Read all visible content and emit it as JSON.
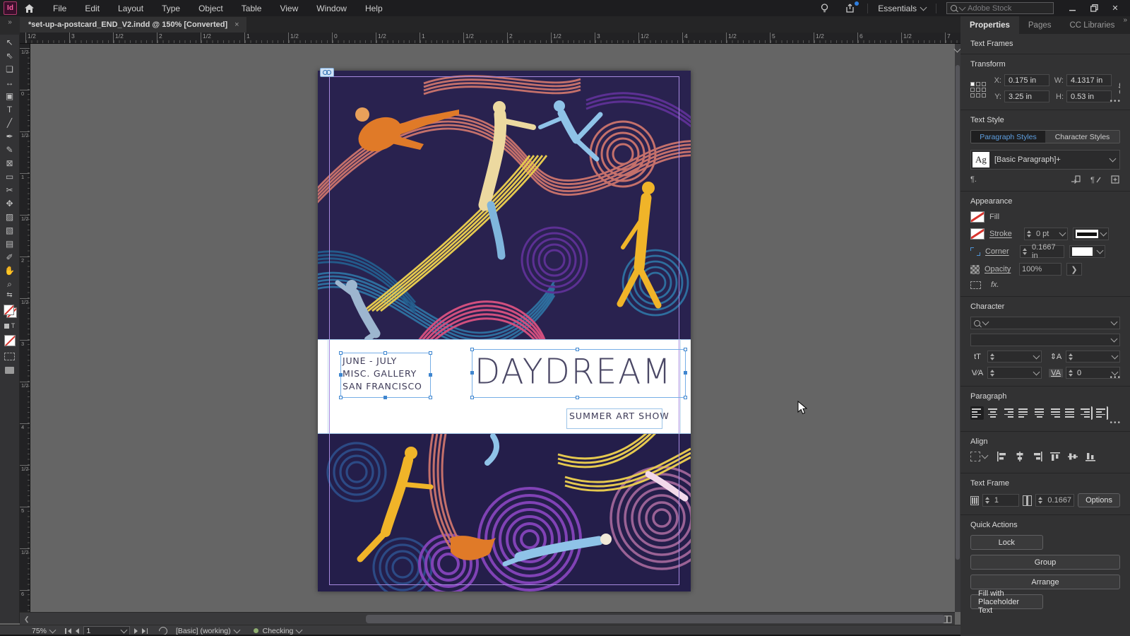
{
  "app": {
    "logo": "Id",
    "menus": [
      "File",
      "Edit",
      "Layout",
      "Type",
      "Object",
      "Table",
      "View",
      "Window",
      "Help"
    ],
    "workspace_label": "Essentials",
    "stock_placeholder": "Adobe Stock",
    "document_tab": "*set-up-a-postcard_END_V2.indd @ 150% [Converted]",
    "close_tab_glyph": "×",
    "panel_flap_glyph": "»"
  },
  "rulers": {
    "horizontal": [
      "1/2",
      "3",
      "1/2",
      "2",
      "1/2",
      "1",
      "1/2",
      "0",
      "1/2",
      "1",
      "1/2",
      "2",
      "1/2",
      "3",
      "1/2",
      "4",
      "1/2",
      "5",
      "1/2",
      "6",
      "1/2",
      "7"
    ],
    "vertical": [
      "1/2",
      "0",
      "1/2",
      "1",
      "1/2",
      "2",
      "1/2",
      "3",
      "1/2",
      "4",
      "1/2",
      "5",
      "1/2",
      "6"
    ]
  },
  "toolbar": {
    "tools": [
      {
        "name": "selection-tool",
        "glyph": "↖"
      },
      {
        "name": "direct-selection-tool",
        "glyph": "⇖"
      },
      {
        "name": "page-tool",
        "glyph": "❏"
      },
      {
        "name": "gap-tool",
        "glyph": "↔"
      },
      {
        "name": "content-collector-tool",
        "glyph": "▣"
      },
      {
        "name": "type-tool",
        "glyph": "T"
      },
      {
        "name": "line-tool",
        "glyph": "╱"
      },
      {
        "name": "pen-tool",
        "glyph": "✒"
      },
      {
        "name": "pencil-tool",
        "glyph": "✎"
      },
      {
        "name": "frame-tool",
        "glyph": "⊠"
      },
      {
        "name": "rectangle-tool",
        "glyph": "▭"
      },
      {
        "name": "scissors-tool",
        "glyph": "✂"
      },
      {
        "name": "free-transform-tool",
        "glyph": "✥"
      },
      {
        "name": "gradient-tool",
        "glyph": "▨"
      },
      {
        "name": "gradient-feather-tool",
        "glyph": "▧"
      },
      {
        "name": "note-tool",
        "glyph": "▤"
      },
      {
        "name": "eyedropper-tool",
        "glyph": "✐"
      },
      {
        "name": "hand-tool",
        "glyph": "✋"
      },
      {
        "name": "zoom-tool",
        "glyph": "⌕"
      }
    ],
    "swap_glyph": "⇆",
    "text_toggle_glyph": "T"
  },
  "canvas": {
    "postcard": {
      "dates": "JUNE - JULY",
      "venue": "MISC. GALLERY",
      "city": "SAN FRANCISCO",
      "title": "DAYDREAM",
      "subtitle": "SUMMER ART SHOW"
    },
    "artwork_colors": {
      "background": "#29224f",
      "background_bottom": "#241e4a",
      "salmon": "#c4706b",
      "blue": "#2e6e9e",
      "deep_blue": "#235a8a",
      "purple": "#5c3093",
      "violet": "#8042b5",
      "yellow": "#e5c94f",
      "magenta": "#d14f7e",
      "orange": "#e07a28",
      "cream": "#ecd9a0",
      "sky": "#8fc3e8",
      "gold": "#f0b429",
      "mauve": "#9a6295",
      "navy_coil": "#2c4a85"
    },
    "selection_color": "#76aee6",
    "guide_color": "#a78ae0"
  },
  "panel": {
    "tabs": [
      "Properties",
      "Pages",
      "CC Libraries"
    ],
    "selection_type": "Text Frames",
    "transform": {
      "title": "Transform",
      "x_label": "X:",
      "x_value": "0.175 in",
      "y_label": "Y:",
      "y_value": "3.25 in",
      "w_label": "W:",
      "w_value": "4.1317 in",
      "h_label": "H:",
      "h_value": "0.53 in"
    },
    "text_style": {
      "title": "Text Style",
      "tab_paragraph": "Paragraph Styles",
      "tab_character": "Character Styles",
      "sample": "Ag",
      "style_name": "[Basic Paragraph]+",
      "pilcrow": "¶."
    },
    "appearance": {
      "title": "Appearance",
      "fill_label": "Fill",
      "stroke_label": "Stroke",
      "stroke_value": "0 pt",
      "corner_label": "Corner",
      "corner_value": "0.1667 in",
      "opacity_label": "Opacity",
      "opacity_value": "100%",
      "fx_label": "fx."
    },
    "character": {
      "title": "Character",
      "size_icon": "tT",
      "leading_icon": "⇕A",
      "kerning_icon": "V∕A",
      "tracking_icon": "VA",
      "tracking_value": "0"
    },
    "paragraph": {
      "title": "Paragraph"
    },
    "align": {
      "title": "Align"
    },
    "text_frame": {
      "title": "Text Frame",
      "columns_value": "1",
      "gutter_value": "0.1667",
      "options_label": "Options"
    },
    "quick_actions": {
      "title": "Quick Actions",
      "buttons": [
        "Lock",
        "Group",
        "Arrange",
        "Fill with Placeholder Text"
      ]
    }
  },
  "statusbar": {
    "zoom_level": "75%",
    "page_number": "1",
    "preflight_profile": "[Basic] (working)",
    "preflight_status": "Checking"
  }
}
